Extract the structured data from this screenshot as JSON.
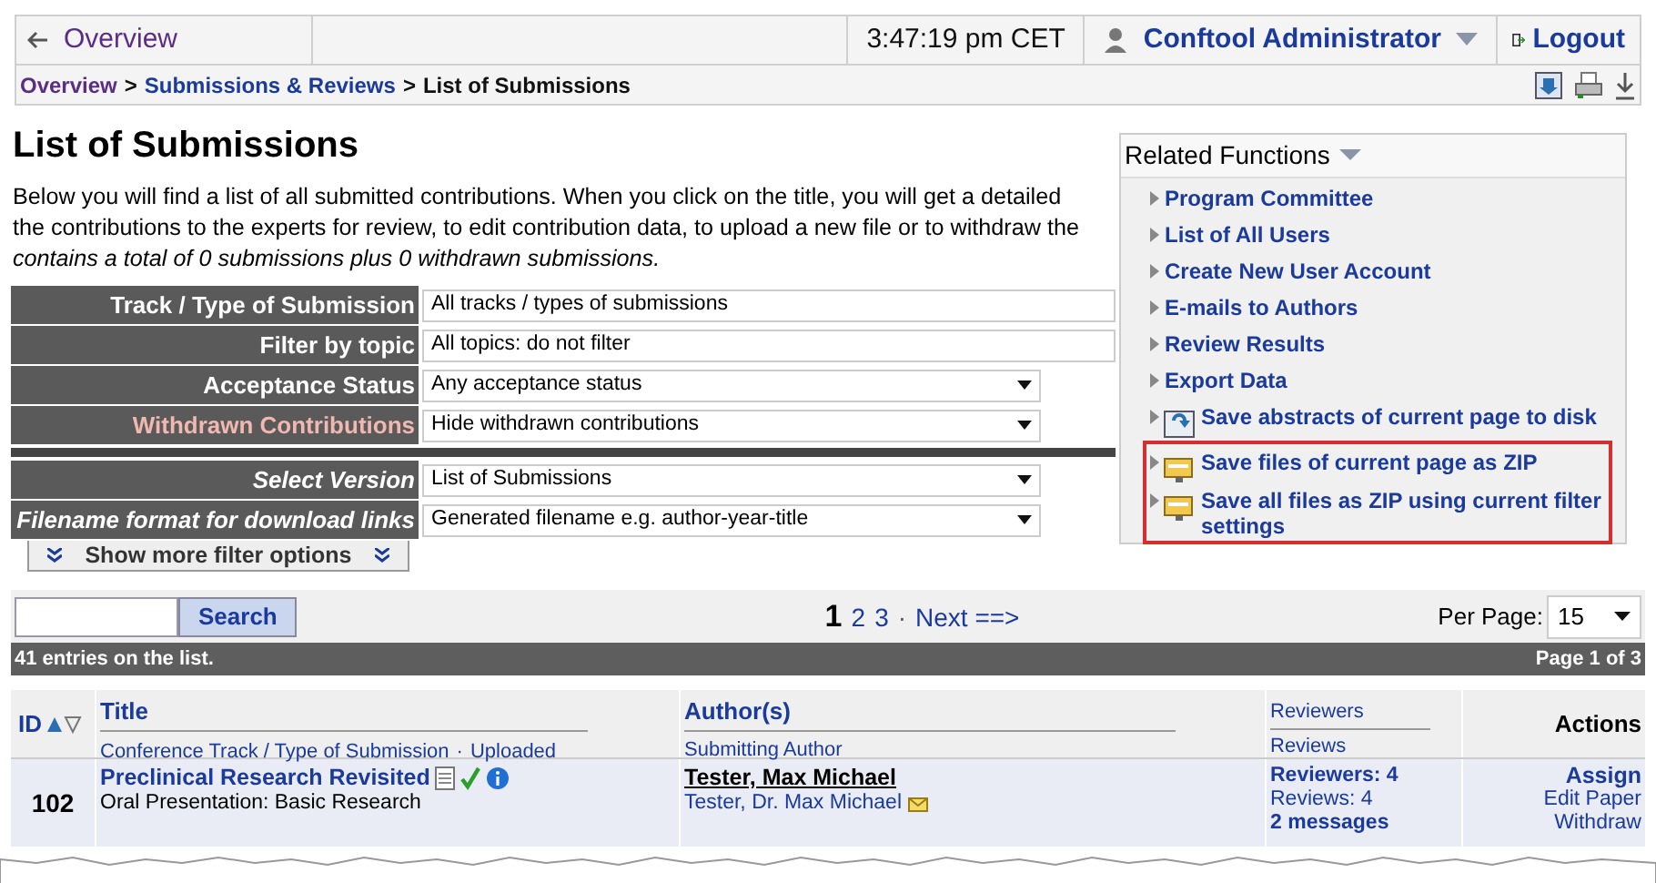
{
  "top_bar": {
    "back": "Overview",
    "time": "3:47:19 pm CET",
    "user": "Conftool Administrator",
    "logout": "Logout"
  },
  "breadcrumb": [
    {
      "label": "Overview",
      "kind": "home"
    },
    {
      "label": ">",
      "kind": "separator"
    },
    {
      "label": "Submissions & Reviews",
      "kind": "link"
    },
    {
      "label": ">",
      "kind": "separator"
    },
    {
      "label": "List of Submissions",
      "kind": "current"
    }
  ],
  "heading": "List of Submissions",
  "intro": [
    "Below you will find a list of all submitted contributions. When you click on the title, you will get a detailed",
    "the contributions to the experts for review, to edit contribution data, to upload a new file or to withdraw the",
    "contains a total of 0 submissions plus 0 withdrawn submissions."
  ],
  "filters": [
    {
      "label": "Track / Type of Submission",
      "value": "All tracks / types of submissions",
      "kind": "text",
      "italic": false,
      "highlighted": false
    },
    {
      "label": "Filter by topic",
      "value": "All topics: do not filter",
      "kind": "text",
      "italic": false,
      "highlighted": false
    },
    {
      "label": "Acceptance Status",
      "value": "Any acceptance status",
      "kind": "select",
      "italic": false,
      "highlighted": false
    },
    {
      "label": "Withdrawn Contributions",
      "value": "Hide withdrawn contributions",
      "kind": "select",
      "italic": false,
      "highlighted": true
    }
  ],
  "options": [
    {
      "label": "Select Version",
      "value": "List of Submissions",
      "kind": "select",
      "italic": true,
      "highlighted": false
    },
    {
      "label": "Filename format for download links",
      "value": "Generated filename e.g. author-year-title",
      "kind": "select",
      "italic": true,
      "highlighted": false
    }
  ],
  "more_filters": "Show more filter options",
  "related": {
    "title": "Related Functions",
    "items": [
      {
        "label": "Program Committee",
        "kind": "link",
        "highlighted": false
      },
      {
        "label": "List of All Users",
        "kind": "link",
        "highlighted": false
      },
      {
        "label": "Create New User Account",
        "kind": "link",
        "highlighted": false
      },
      {
        "label": "E-mails to Authors",
        "kind": "link",
        "highlighted": false
      },
      {
        "label": "Review Results",
        "kind": "link",
        "highlighted": false
      },
      {
        "label": "Export Data",
        "kind": "link",
        "highlighted": false
      },
      {
        "label": "Save abstracts of current page to disk",
        "kind": "disk",
        "highlighted": false
      },
      {
        "label": "Save files of current page as ZIP",
        "kind": "zip",
        "highlighted": true
      },
      {
        "label": "Save **all** files as ZIP using current filter settings",
        "kind": "zip",
        "highlighted": true
      }
    ]
  },
  "search": {
    "button": "Search"
  },
  "pages": [
    {
      "label": "1",
      "selected": true
    },
    {
      "label": "2",
      "selected": false
    },
    {
      "label": "3",
      "selected": false
    }
  ],
  "pages_separator": "·",
  "next": "Next ==>",
  "per_page": {
    "label": "Per Page:",
    "value": "15"
  },
  "summary": {
    "entries": "41 entries on the list.",
    "page": "Page 1 of 3"
  },
  "table": {
    "columns": {
      "id": "ID",
      "title": "Title",
      "title_sub": [
        "Conference Track / Type of Submission",
        "·",
        "Uploaded"
      ],
      "authors": "Author(s)",
      "authors_sub": "Submitting Author",
      "reviewers": "Reviewers",
      "reviews": "Reviews",
      "actions": "Actions"
    },
    "rows": [
      {
        "id": "102",
        "title": "Preclinical Research Revisited",
        "accepted": true,
        "track": "Oral Presentation: Basic Research",
        "authors": "Tester, Max Michael",
        "submitter": "Tester, Dr. Max Michael",
        "reviewers": "Reviewers: 4",
        "reviews": "Reviews: 4",
        "messages": "2 messages",
        "actions": [
          "Assign",
          "Edit Paper",
          "Withdraw"
        ]
      }
    ]
  }
}
